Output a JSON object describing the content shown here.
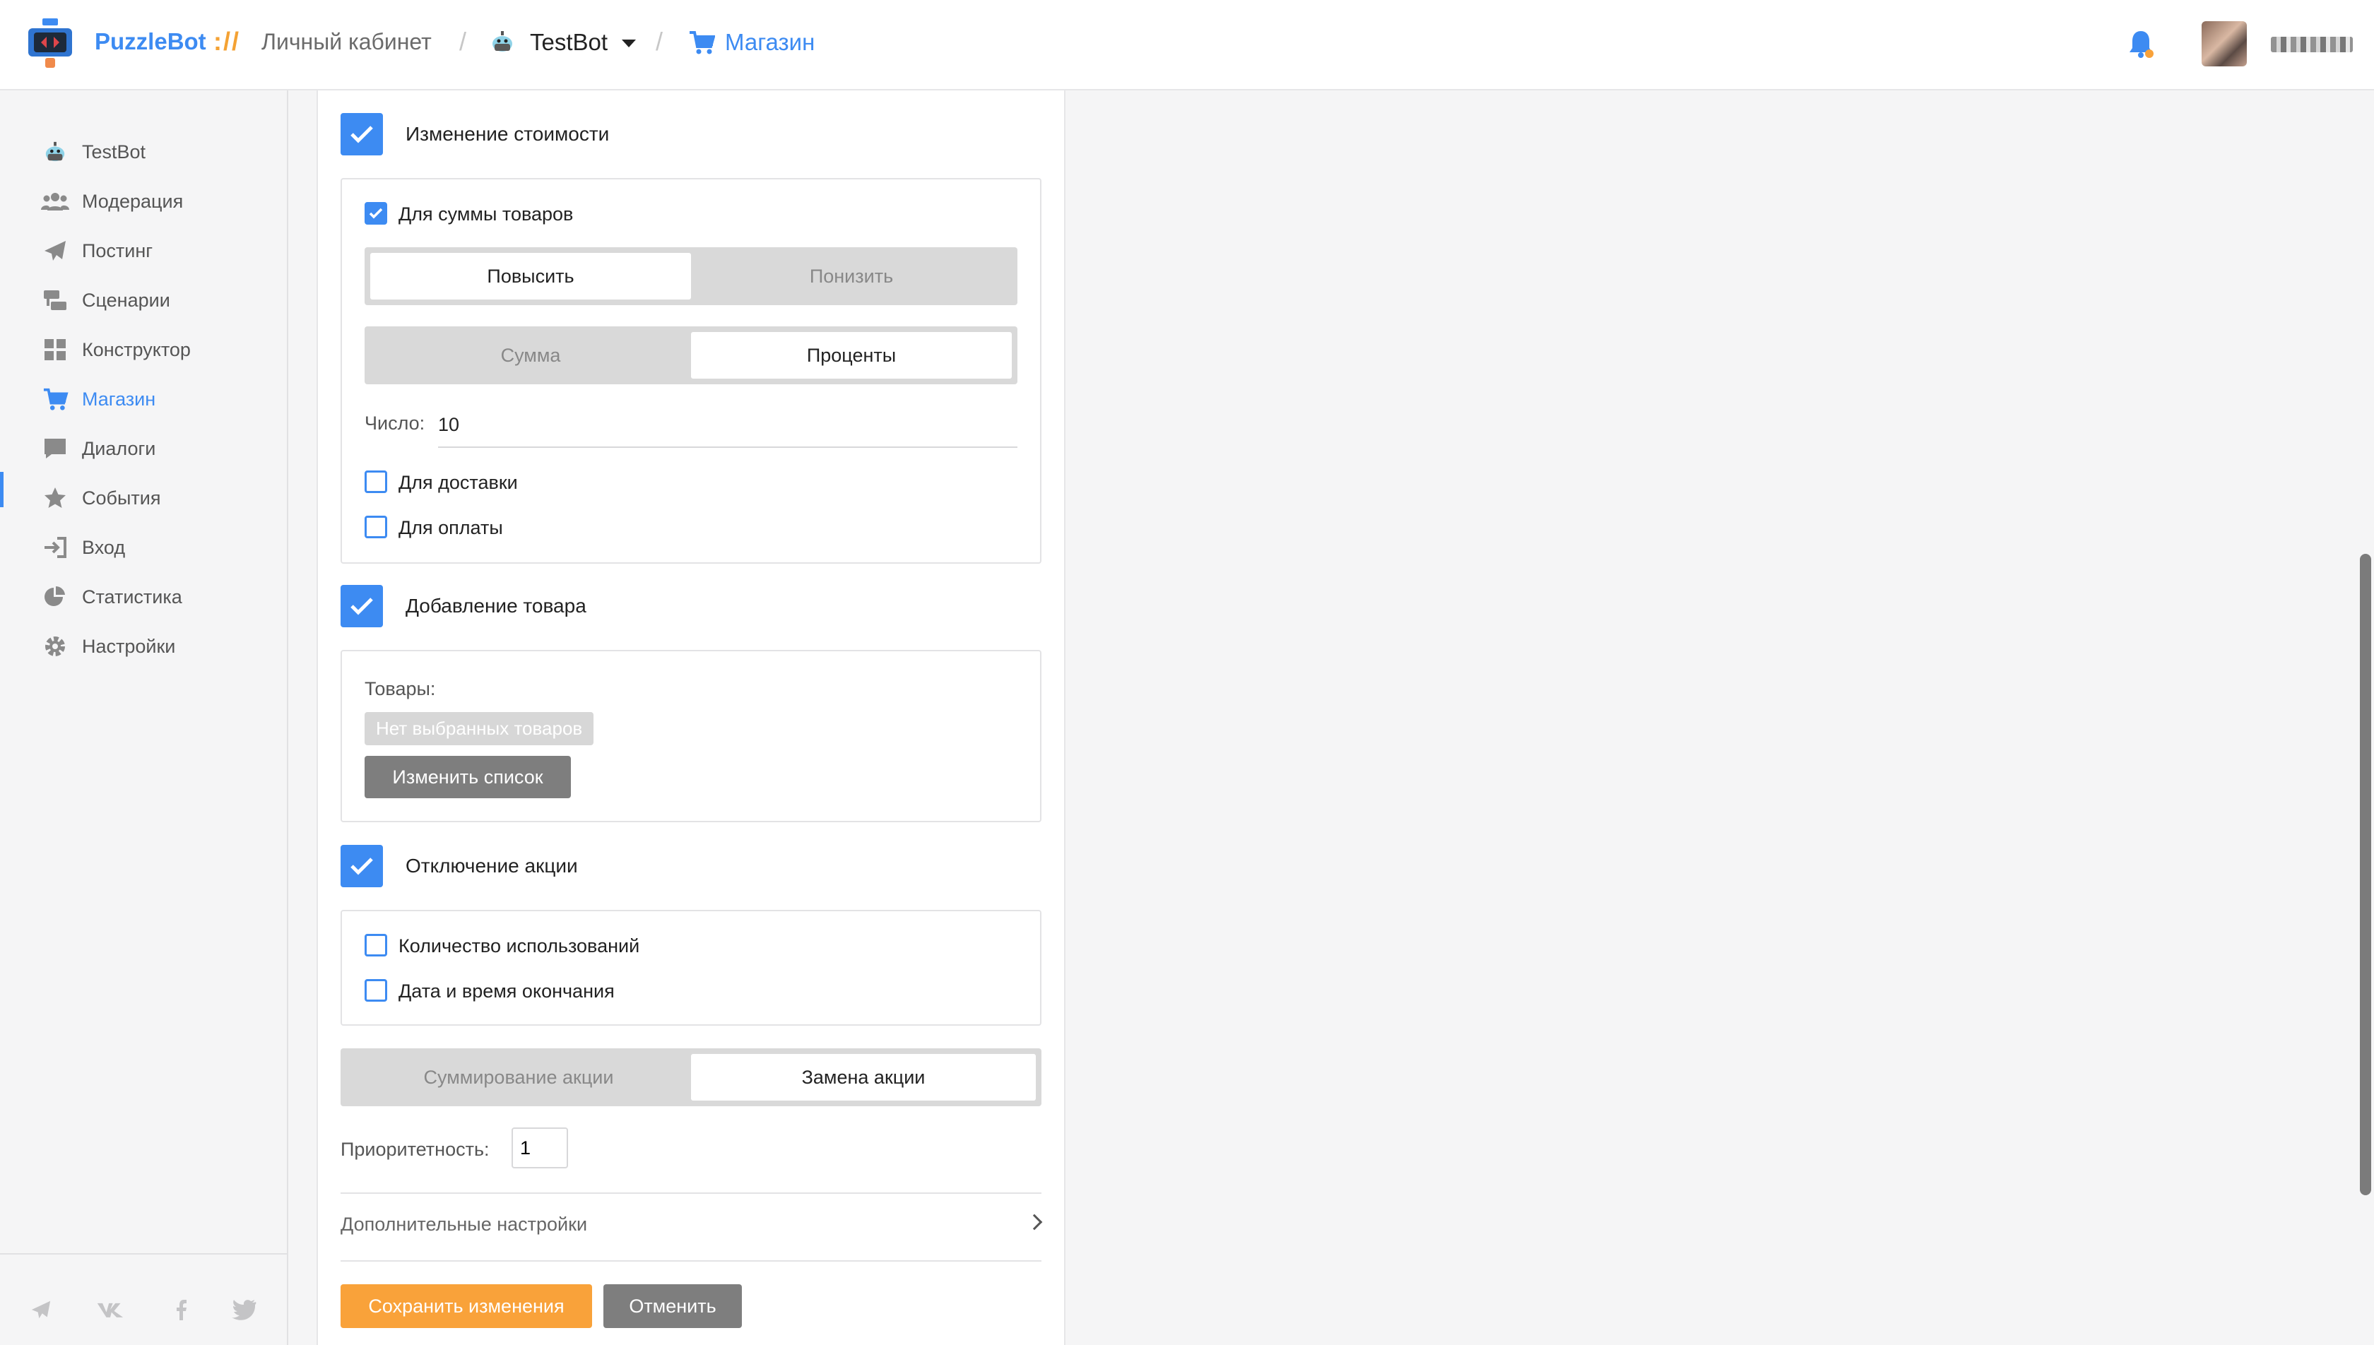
{
  "header": {
    "brand": "PuzzleBot",
    "brand_separator": "://",
    "cabinet": "Личный кабинет",
    "separator": "/",
    "bot_name": "TestBot",
    "section": "Магазин"
  },
  "sidebar": {
    "items": [
      {
        "label": "TestBot",
        "icon": "robot-icon"
      },
      {
        "label": "Модерация",
        "icon": "users-icon"
      },
      {
        "label": "Постинг",
        "icon": "paper-plane-icon"
      },
      {
        "label": "Сценарии",
        "icon": "scenario-icon"
      },
      {
        "label": "Конструктор",
        "icon": "grid-icon"
      },
      {
        "label": "Магазин",
        "icon": "cart-icon",
        "active": true
      },
      {
        "label": "Диалоги",
        "icon": "chat-icon"
      },
      {
        "label": "События",
        "icon": "star-icon"
      },
      {
        "label": "Вход",
        "icon": "sign-in-icon"
      },
      {
        "label": "Статистика",
        "icon": "pie-chart-icon"
      },
      {
        "label": "Настройки",
        "icon": "gear-icon"
      }
    ],
    "social": [
      "telegram-icon",
      "vk-icon",
      "facebook-icon",
      "twitter-icon"
    ]
  },
  "form": {
    "price_change": {
      "label": "Изменение стоимости",
      "checked": true,
      "for_goods_sum": "Для суммы товаров",
      "direction": {
        "options": [
          "Повысить",
          "Понизить"
        ],
        "selected": "Повысить"
      },
      "mode": {
        "options": [
          "Сумма",
          "Проценты"
        ],
        "selected": "Проценты"
      },
      "number_label": "Число:",
      "number_value": "10",
      "for_delivery": "Для доставки",
      "for_payment": "Для оплаты"
    },
    "add_goods": {
      "label": "Добавление товара",
      "checked": true,
      "goods_label": "Товары:",
      "empty_chip": "Нет выбранных товаров",
      "change_list": "Изменить список"
    },
    "disable_promo": {
      "label": "Отключение акции",
      "checked": true,
      "usage_count": "Количество использований",
      "end_datetime": "Дата и время окончания"
    },
    "combine": {
      "options": [
        "Суммирование акции",
        "Замена акции"
      ],
      "selected": "Замена акции"
    },
    "priority_label": "Приоритетность:",
    "priority_value": "1",
    "advanced": "Дополнительные настройки",
    "save": "Сохранить изменения",
    "cancel": "Отменить"
  },
  "colors": {
    "accent": "#3d8bf2",
    "save": "#f9a23a",
    "gray_button": "#7e7e7e"
  }
}
